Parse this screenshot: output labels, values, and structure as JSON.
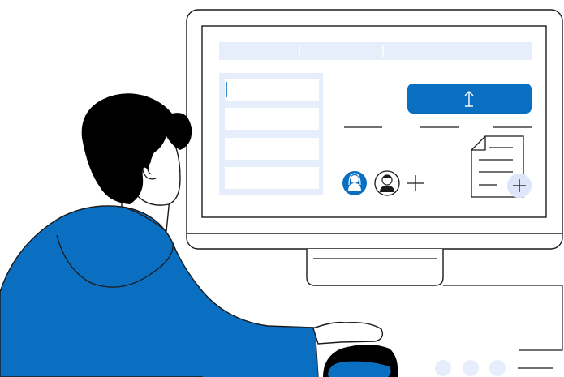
{
  "illustration": {
    "subject": "person-at-computer-uploading-document",
    "colors": {
      "accent": "#0b6fc1",
      "accent_light": "#e6eefc",
      "outline": "#1a1a1a",
      "hair": "#000000",
      "skin": "#ffffff",
      "background": "#ffffff"
    }
  },
  "screen": {
    "upload_button_icon": "upload-arrow-icon",
    "add_user_icon": "plus-icon",
    "document_add_icon": "plus-icon",
    "avatars": [
      "female-avatar-icon",
      "male-avatar-icon"
    ],
    "form_field_count": 4,
    "pagination_dots": 3
  }
}
